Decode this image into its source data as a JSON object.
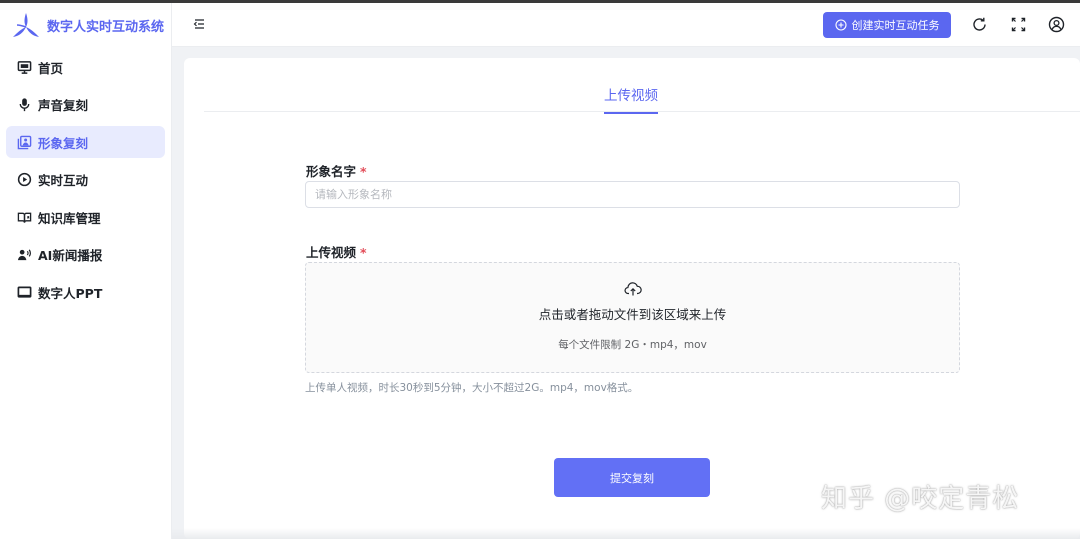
{
  "app": {
    "title": "数字人实时互动系统",
    "brand_color": "#5b67f0"
  },
  "sidebar": {
    "items": [
      {
        "label": "首页",
        "icon": "monitor-icon",
        "active": false
      },
      {
        "label": "声音复刻",
        "icon": "microphone-icon",
        "active": false
      },
      {
        "label": "形象复刻",
        "icon": "portrait-stack-icon",
        "active": true
      },
      {
        "label": "实时互动",
        "icon": "play-circle-icon",
        "active": false
      },
      {
        "label": "知识库管理",
        "icon": "book-icon",
        "active": false
      },
      {
        "label": "AI新闻播报",
        "icon": "speaker-person-icon",
        "active": false
      },
      {
        "label": "数字人PPT",
        "icon": "presentation-icon",
        "active": false
      }
    ]
  },
  "header": {
    "create_task_label": "创建实时互动任务",
    "icons": [
      "menu-collapse-icon",
      "refresh-icon",
      "fullscreen-icon",
      "user-icon"
    ]
  },
  "main": {
    "tab_label": "上传视频",
    "name_field": {
      "label": "形象名字",
      "required_mark": "*",
      "placeholder": "请输入形象名称",
      "value": ""
    },
    "upload_field": {
      "label": "上传视频",
      "required_mark": "*",
      "main_text": "点击或者拖动文件到该区域来上传",
      "limit_text": "每个文件限制 2G・mp4，mov"
    },
    "hint_text": "上传单人视频，时长30秒到5分钟，大小不超过2G。mp4，mov格式。",
    "submit_label": "提交复刻"
  },
  "watermark": "知乎 @咬定青松"
}
